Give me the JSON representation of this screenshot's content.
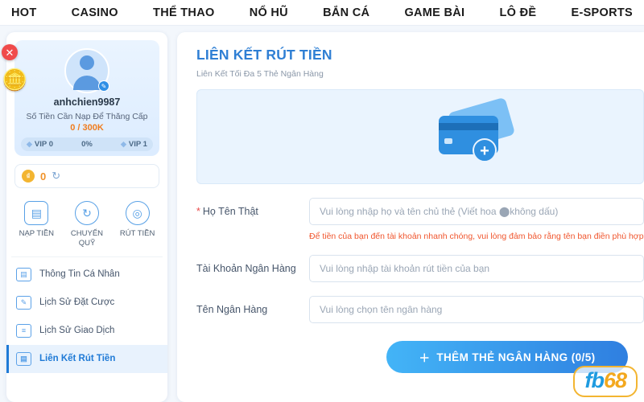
{
  "topnav": {
    "items": [
      {
        "label": "HOT"
      },
      {
        "label": "CASINO"
      },
      {
        "label": "THỂ THAO"
      },
      {
        "label": "NỔ HŨ"
      },
      {
        "label": "BẮN CÁ"
      },
      {
        "label": "GAME BÀI"
      },
      {
        "label": "LÔ ĐỀ"
      },
      {
        "label": "E-SPORTS"
      }
    ]
  },
  "sidebar": {
    "close_label": "✕",
    "profile": {
      "username": "anhchien9987",
      "upgrade_text": "Số Tiền Cần Nạp Để Thăng Cấp",
      "upgrade_amount": "0 / 300K",
      "vip_current": "VIP 0",
      "vip_percent": "0%",
      "vip_next": "VIP 1"
    },
    "balance": {
      "coin_symbol": "₫",
      "amount": "0",
      "refresh_icon": "↻"
    },
    "quick_actions": [
      {
        "label": "NẠP TIỀN",
        "icon": "wallet-icon"
      },
      {
        "label": "CHUYỂN QUỸ",
        "icon": "transfer-icon"
      },
      {
        "label": "RÚT TIỀN",
        "icon": "withdraw-icon"
      }
    ],
    "menu": [
      {
        "label": "Thông Tin Cá Nhân",
        "icon": "id-card-icon",
        "active": false
      },
      {
        "label": "Lịch Sử Đặt Cược",
        "icon": "history-bet-icon",
        "active": false
      },
      {
        "label": "Lịch Sử Giao Dịch",
        "icon": "history-transaction-icon",
        "active": false
      },
      {
        "label": "Liên Kết Rút Tiền",
        "icon": "link-withdraw-icon",
        "active": true
      }
    ]
  },
  "main": {
    "title": "LIÊN KẾT RÚT TIỀN",
    "subtitle": "Liên Kết Tối Đa 5 Thẻ Ngân Hàng",
    "fields": [
      {
        "label": "Họ Tên Thật",
        "required": true,
        "placeholder": "Vui lòng nhập họ và tên chủ thẻ (Viết hoa ⬤không dấu)"
      },
      {
        "label": "Tài Khoản Ngân Hàng",
        "required": false,
        "placeholder": "Vui lòng nhập tài khoản rút tiền của bạn"
      },
      {
        "label": "Tên Ngân Hàng",
        "required": false,
        "placeholder": "Vui lòng chọn tên ngân hàng"
      }
    ],
    "warning": "Để tiền của bạn đến tài khoản nhanh chóng, vui lòng đảm bảo rằng tên bạn điền phù hợp",
    "submit_label": "THÊM THẺ NGÂN HÀNG (0/5)",
    "submit_plus": "＋"
  },
  "watermark": {
    "text_a": "fb",
    "text_b": "68"
  },
  "colors": {
    "accent": "#2f7fd4",
    "warning": "#f0562e",
    "orange": "#f0932a",
    "active_bg": "#e8f2fd"
  }
}
